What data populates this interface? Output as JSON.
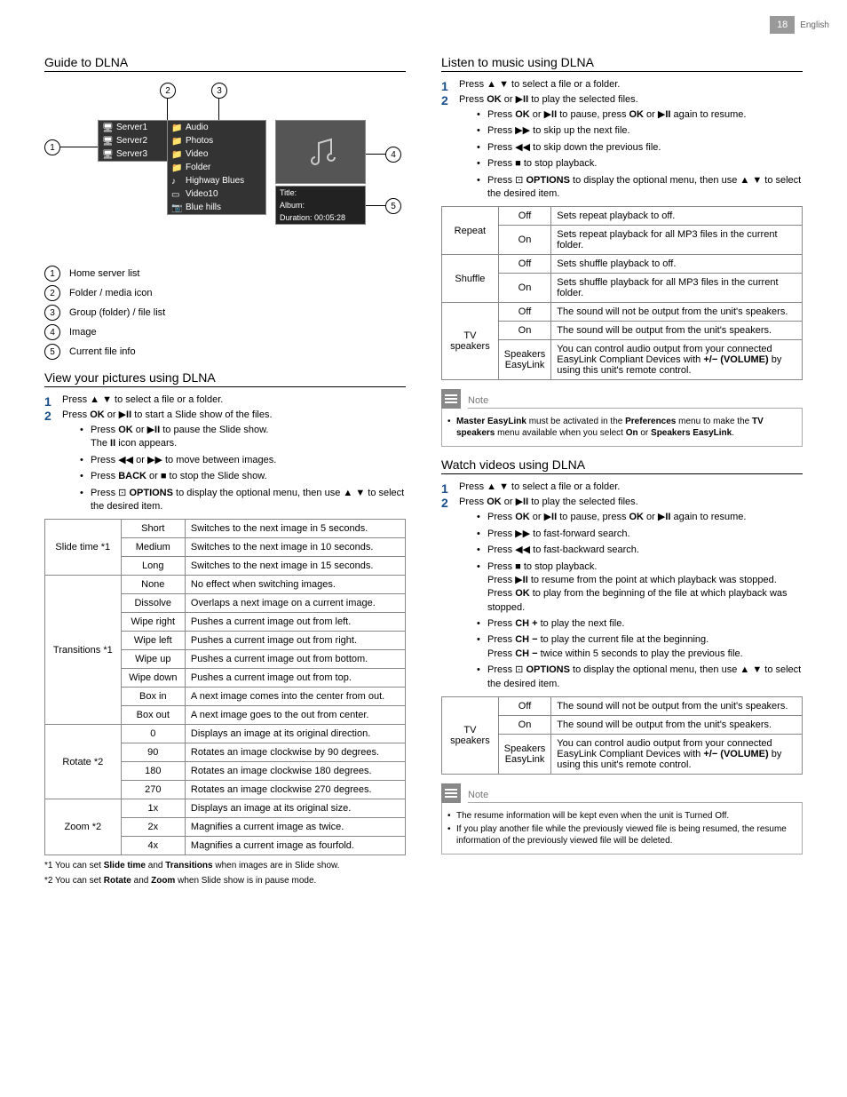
{
  "header": {
    "page_num": "18",
    "lang": "English"
  },
  "left": {
    "h_guide": "Guide to DLNA",
    "diagram": {
      "servers": [
        "Server1",
        "Server2",
        "Server3"
      ],
      "cats": [
        "Audio",
        "Photos",
        "Video",
        "Folder"
      ],
      "files": [
        "Highway Blues",
        "Video10",
        "Blue hills"
      ],
      "info": {
        "t": "Title:",
        "a": "Album:",
        "d": "Duration: 00:05:28"
      }
    },
    "legend": [
      {
        "n": "1",
        "t": "Home server list"
      },
      {
        "n": "2",
        "t": "Folder / media icon"
      },
      {
        "n": "3",
        "t": "Group (folder) / file list"
      },
      {
        "n": "4",
        "t": "Image"
      },
      {
        "n": "5",
        "t": "Current file info"
      }
    ],
    "h_view": "View your pictures using DLNA",
    "view_s1": "Press ▲ ▼ to select a file or a folder.",
    "view_s2": "Press OK or ▶II to start a Slide show of the files.",
    "view_b": [
      "Press OK or ▶II to pause the Slide show.\nThe II icon appears.",
      "Press ◀◀ or ▶▶ to move between images.",
      "Press BACK or ■ to stop the Slide show.",
      "Press ⊡ OPTIONS to display the optional menu, then use ▲ ▼ to select the desired item."
    ],
    "tab": {
      "slide": {
        "h": "Slide time *1",
        "r": [
          [
            "Short",
            "Switches to the next image in 5 seconds."
          ],
          [
            "Medium",
            "Switches to the next image in 10 seconds."
          ],
          [
            "Long",
            "Switches to the next image in 15 seconds."
          ]
        ]
      },
      "trans": {
        "h": "Transitions *1",
        "r": [
          [
            "None",
            "No effect when switching images."
          ],
          [
            "Dissolve",
            "Overlaps a next image on a current image."
          ],
          [
            "Wipe right",
            "Pushes a current image out from left."
          ],
          [
            "Wipe left",
            "Pushes a current image out from right."
          ],
          [
            "Wipe up",
            "Pushes a current image out from bottom."
          ],
          [
            "Wipe down",
            "Pushes a current image out from top."
          ],
          [
            "Box in",
            "A next image comes into the center from out."
          ],
          [
            "Box out",
            "A next image goes to the out from center."
          ]
        ]
      },
      "rot": {
        "h": "Rotate *2",
        "r": [
          [
            "0",
            "Displays an image at its original direction."
          ],
          [
            "90",
            "Rotates an image clockwise by 90 degrees."
          ],
          [
            "180",
            "Rotates an image clockwise 180 degrees."
          ],
          [
            "270",
            "Rotates an image clockwise 270 degrees."
          ]
        ]
      },
      "zoom": {
        "h": "Zoom *2",
        "r": [
          [
            "1x",
            "Displays an image at its original size."
          ],
          [
            "2x",
            "Magnifies a current image as twice."
          ],
          [
            "4x",
            "Magnifies a current image as fourfold."
          ]
        ]
      }
    },
    "fn1": "*1 You can set Slide time and Transitions when images are in Slide show.",
    "fn2": "*2 You can set Rotate and Zoom when Slide show is in pause mode.",
    "fn1b": [
      "Slide time",
      "Transitions"
    ],
    "fn2b": [
      "Rotate",
      "Zoom"
    ]
  },
  "right": {
    "h_music": "Listen to music using DLNA",
    "m_s1": "Press ▲ ▼ to select a file or a folder.",
    "m_s2": "Press OK or ▶II to play the selected files.",
    "m_b": [
      "Press OK or ▶II to pause, press OK or ▶II again to resume.",
      "Press ▶▶ to skip up the next file.",
      "Press ◀◀ to skip down the previous file.",
      "Press ■ to stop playback.",
      "Press ⊡ OPTIONS to display the optional menu, then use ▲ ▼ to select the desired item."
    ],
    "m_tab": [
      {
        "h": "Repeat",
        "r": [
          [
            "Off",
            "Sets repeat playback to off."
          ],
          [
            "On",
            "Sets repeat playback for all MP3 files in the current folder."
          ]
        ]
      },
      {
        "h": "Shuffle",
        "r": [
          [
            "Off",
            "Sets shuffle playback to off."
          ],
          [
            "On",
            "Sets shuffle playback for all MP3 files in the current folder."
          ]
        ]
      },
      {
        "h": "TV speakers",
        "r": [
          [
            "Off",
            "The sound will not be output from the unit's speakers."
          ],
          [
            "On",
            "The sound will be output from the unit's speakers."
          ],
          [
            "Speakers EasyLink",
            "You can control audio output from your connected EasyLink Compliant Devices with +/− (VOLUME) by using this unit's remote control."
          ]
        ]
      }
    ],
    "note1_t": "Note",
    "note1": "Master EasyLink must be activated in the Preferences menu to make the TV speakers menu available when you select On or Speakers EasyLink.",
    "note1b": [
      "Master EasyLink",
      "Preferences",
      "TV speakers",
      "On",
      "Speakers EasyLink"
    ],
    "h_video": "Watch videos using DLNA",
    "v_s1": "Press ▲ ▼ to select a file or a folder.",
    "v_s2": "Press OK or ▶II to play the selected files.",
    "v_b": [
      "Press OK or ▶II to pause, press OK or ▶II again to resume.",
      "Press ▶▶ to fast-forward search.",
      "Press ◀◀ to fast-backward search.",
      "Press ■ to stop playback.\nPress ▶II to resume from the point at which playback was stopped. Press OK to play from the beginning of the file at which playback was stopped.",
      "Press CH + to play the next file.",
      "Press CH − to play the current file at the beginning.\nPress CH − twice within 5 seconds to play the previous file.",
      "Press ⊡ OPTIONS to display the optional menu, then use ▲ ▼ to select the desired item."
    ],
    "v_tab": [
      {
        "h": "TV speakers",
        "r": [
          [
            "Off",
            "The sound will not be output from the unit's speakers."
          ],
          [
            "On",
            "The sound will be output from the unit's speakers."
          ],
          [
            "Speakers EasyLink",
            "You can control audio output from your connected EasyLink Compliant Devices with +/− (VOLUME) by using this unit's remote control."
          ]
        ]
      }
    ],
    "note2_t": "Note",
    "note2": [
      "The resume information will be kept even when the unit is Turned Off.",
      "If you play another file while the previously viewed file is being resumed, the resume information of the previously viewed file will be deleted."
    ]
  }
}
